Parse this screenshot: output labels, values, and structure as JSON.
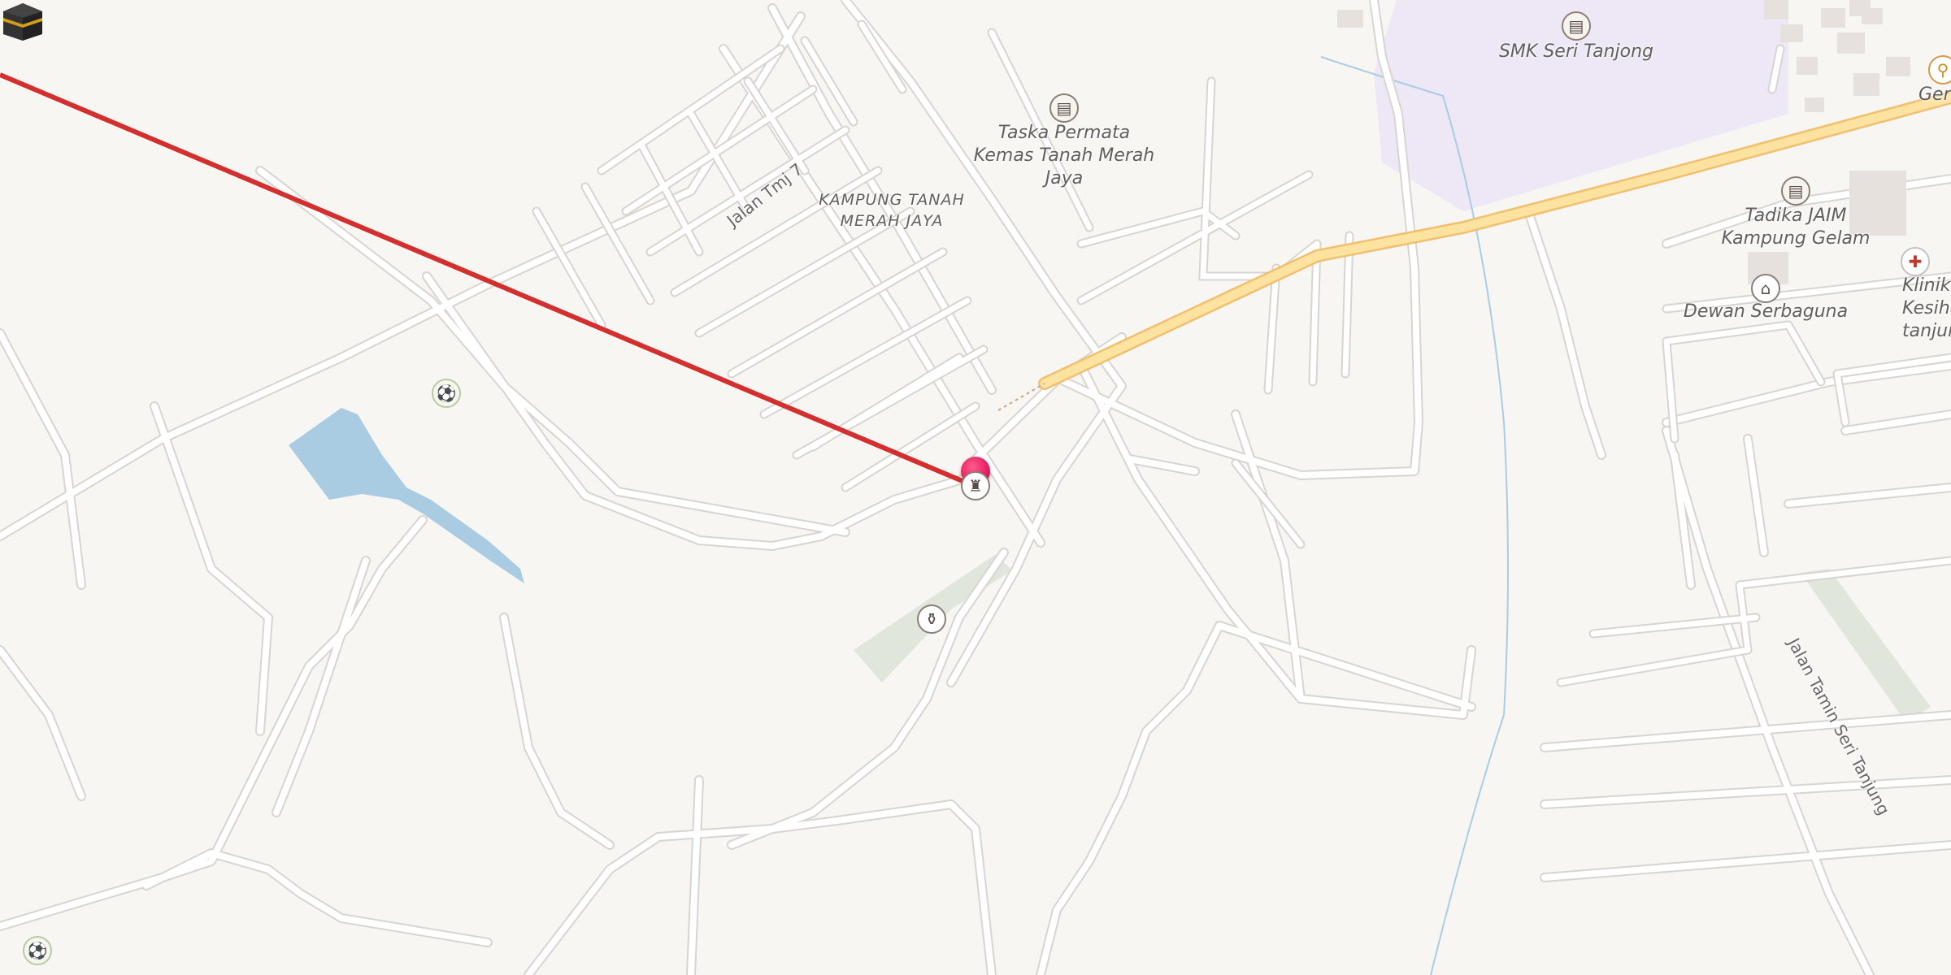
{
  "map": {
    "colors": {
      "background": "#f8f6f3",
      "road": "#ffffff",
      "road_casing": "#d8d4d0",
      "main_road": "#fde2a0",
      "main_road_casing": "#f0c070",
      "school_area": "#ede7f6",
      "water": "#a9cce3",
      "green_area": "#e1e6dc",
      "qibla_line": "#d32f2f"
    },
    "labels": {
      "kampung": "KAMPUNG TANAH MERAH JAYA",
      "taska": "Taska Permata Kemas Tanah Merah Jaya",
      "smk": "SMK Seri Tanjong",
      "tadika": "Tadika JAIM Kampung Gelam",
      "dewan": "Dewan Serbaguna",
      "klinik": "Klinik Kesiha tanjung Kli",
      "gerai": "Gerai"
    },
    "streets": {
      "jalan_tmj7": "Jalan Tmj 7",
      "jalan_taman": "Jalan Tamin Seri Tanjung"
    },
    "pois": [
      {
        "name": "school-icon",
        "type": "school",
        "glyph": "▤"
      },
      {
        "name": "school-icon",
        "type": "school",
        "glyph": "▤"
      },
      {
        "name": "school-icon",
        "type": "school",
        "glyph": "▤"
      },
      {
        "name": "townhall-icon",
        "type": "townhall",
        "glyph": "⌂"
      },
      {
        "name": "mosque-icon",
        "type": "mosque",
        "glyph": "♜"
      },
      {
        "name": "cemetery-icon",
        "type": "cemetery",
        "glyph": "⚱"
      },
      {
        "name": "clinic-icon",
        "type": "clinic",
        "glyph": "✚"
      },
      {
        "name": "sports-icon",
        "type": "park",
        "glyph": "⚽"
      },
      {
        "name": "sports-icon",
        "type": "park",
        "glyph": "⚽"
      },
      {
        "name": "restaurant-icon",
        "type": "food",
        "glyph": "⚲"
      }
    ],
    "marker": "location-pin",
    "kaaba": "kaaba-icon",
    "qibla_line": "qibla-direction-line"
  }
}
